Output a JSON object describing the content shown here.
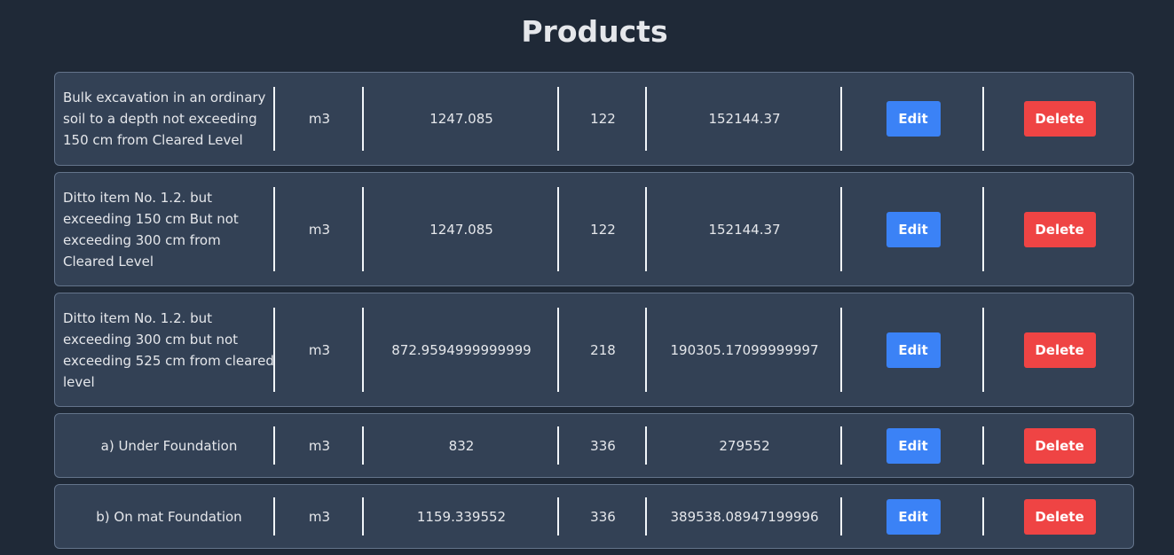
{
  "page": {
    "title": "Products"
  },
  "buttons": {
    "edit": "Edit",
    "delete": "Delete"
  },
  "colors": {
    "background": "#1f2937",
    "row": "#334155",
    "edit": "#3b82f6",
    "delete": "#ef4444"
  },
  "rows": [
    {
      "description": "Bulk excavation in an ordinary soil to a depth not exceeding 150 cm from Cleared Level",
      "unit": "m3",
      "quantity": "1247.085",
      "rate": "122",
      "amount": "152144.37"
    },
    {
      "description": "Ditto item No. 1.2. but exceeding 150 cm But not exceeding 300 cm from Cleared Level",
      "unit": "m3",
      "quantity": "1247.085",
      "rate": "122",
      "amount": "152144.37"
    },
    {
      "description": "Ditto item No. 1.2. but exceeding 300 cm but not exceeding 525 cm from cleared level",
      "unit": "m3",
      "quantity": "872.9594999999999",
      "rate": "218",
      "amount": "190305.17099999997"
    },
    {
      "description": "a) Under Foundation",
      "unit": "m3",
      "quantity": "832",
      "rate": "336",
      "amount": "279552"
    },
    {
      "description": "b) On mat Foundation",
      "unit": "m3",
      "quantity": "1159.339552",
      "rate": "336",
      "amount": "389538.08947199996"
    }
  ]
}
